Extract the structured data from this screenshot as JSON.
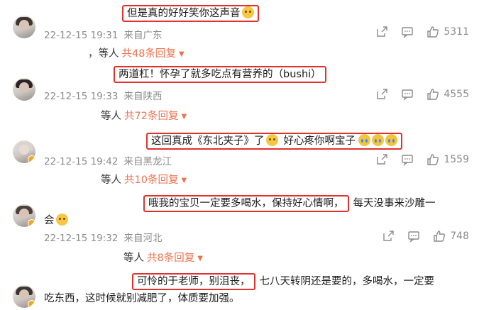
{
  "comments": [
    {
      "text_highlighted": "但是真的好好笑你这声音",
      "text_plain": "",
      "date": "22-12-15 19:31",
      "location": "来自广东",
      "likes": "5311",
      "replies_who": "，等人",
      "replies_count": "共48条回复"
    },
    {
      "text_highlighted": "两道杠！怀孕了就多吃点有营养的（bushi）",
      "text_plain": "",
      "date": "22-12-15 19:33",
      "location": "来自陕西",
      "likes": "4555",
      "replies_who": "等人",
      "replies_count": "共72条回复"
    },
    {
      "text_highlighted_a": "这回真成《东北夹子》了",
      "text_highlighted_b": "好心疼你啊宝子",
      "date": "22-12-15 19:42",
      "location": "来自黑龙江",
      "likes": "1559",
      "replies_who": "等人",
      "replies_count": "共10条回复"
    },
    {
      "text_highlighted": "哦我的宝贝一定要多喝水，保持好心情啊，",
      "text_plain": "每天没事来沙雕一",
      "text_line2": "会",
      "date": "22-12-15 19:32",
      "location": "来自河北",
      "likes": "748",
      "replies_who": "等人",
      "replies_count": "共8条回复"
    },
    {
      "text_highlighted": "可怜的于老师，别沮丧，",
      "text_plain": "七八天转阴还是要的，多喝水，一定要",
      "text_line2": "吃东西，这时候就别减肥了，体质要加强。"
    }
  ],
  "icons": {
    "share": "share-icon",
    "comment": "comment-icon",
    "like": "thumbs-up-icon",
    "dropdown": "triangle-down-icon"
  },
  "colors": {
    "highlight_border": "#e0322c",
    "reply_link": "#eb7350",
    "meta_gray": "#8c8c8c"
  }
}
